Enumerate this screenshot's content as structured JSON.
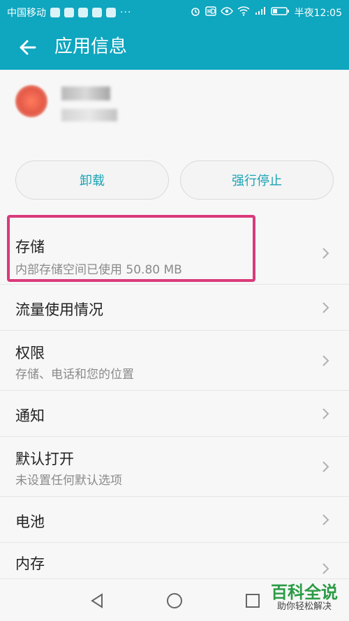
{
  "status_bar": {
    "carrier": "中国移动",
    "time_label": "半夜12:05",
    "more": "···"
  },
  "app_bar": {
    "title": "应用信息"
  },
  "buttons": {
    "uninstall": "卸载",
    "force_stop": "强行停止"
  },
  "list": {
    "items": [
      {
        "title": "存储",
        "subtitle": "内部存储空间已使用 50.80 MB"
      },
      {
        "title": "流量使用情况",
        "subtitle": ""
      },
      {
        "title": "权限",
        "subtitle": "存储、电话和您的位置"
      },
      {
        "title": "通知",
        "subtitle": ""
      },
      {
        "title": "默认打开",
        "subtitle": "未设置任何默认选项"
      },
      {
        "title": "电池",
        "subtitle": ""
      },
      {
        "title": "内存",
        "subtitle": ""
      }
    ]
  },
  "watermark": {
    "big": "百科全说",
    "small": "助你轻松解决"
  },
  "colors": {
    "accent": "#0fa6bf",
    "button_text": "#1aa3b5",
    "highlight": "#d93a7a",
    "watermark_green": "#2a9b45"
  }
}
